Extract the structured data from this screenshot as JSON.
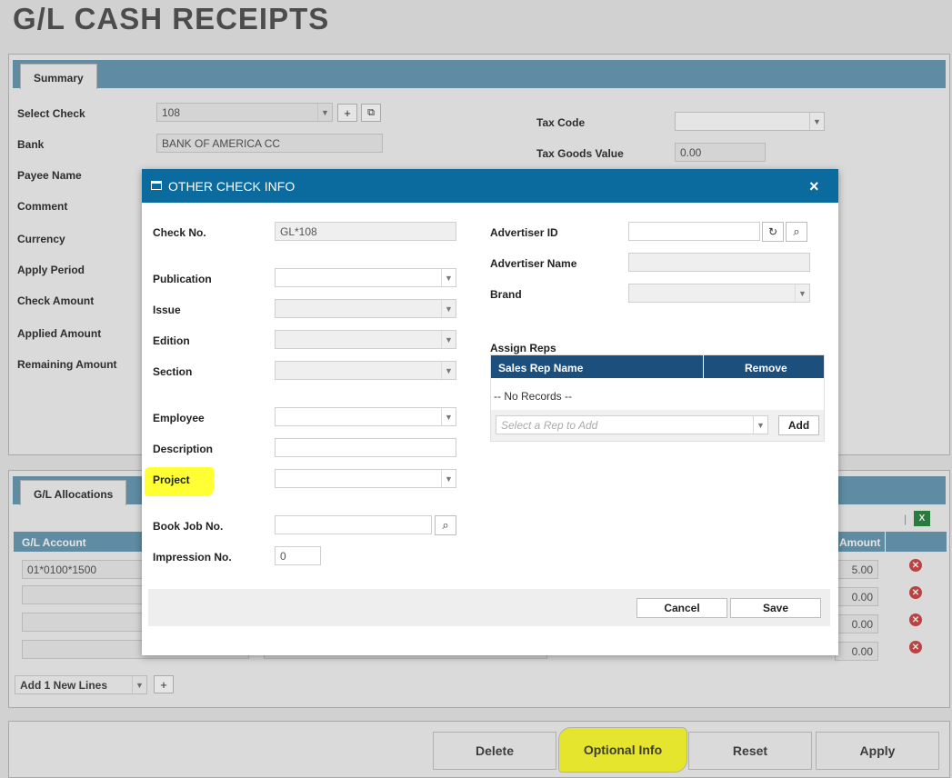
{
  "page": {
    "title": "G/L CASH RECEIPTS"
  },
  "summary": {
    "tab_label": "Summary",
    "labels": {
      "select_check": "Select Check",
      "bank": "Bank",
      "payee_name": "Payee Name",
      "comment": "Comment",
      "currency": "Currency",
      "apply_period": "Apply Period",
      "check_amount": "Check Amount",
      "applied_amount": "Applied Amount",
      "remaining_amount": "Remaining Amount",
      "tax_code": "Tax Code",
      "tax_goods_value": "Tax Goods Value"
    },
    "values": {
      "select_check": "108",
      "bank": "BANK OF AMERICA CC",
      "tax_code": "",
      "tax_goods_value": "0.00"
    }
  },
  "allocations": {
    "tab_label": "G/L Allocations",
    "columns": {
      "gl_account": "G/L Account",
      "amount": "Amount"
    },
    "rows": [
      {
        "gl_account": "01*0100*1500",
        "amount": "5.00"
      },
      {
        "gl_account": "",
        "amount": "0.00"
      },
      {
        "gl_account": "",
        "amount": "0.00"
      },
      {
        "gl_account": "",
        "amount": "0.00"
      }
    ],
    "add_lines_select": "Add 1 New Lines",
    "add_icon": "+"
  },
  "actions": {
    "delete": "Delete",
    "optional_info": "Optional Info",
    "reset": "Reset",
    "apply": "Apply"
  },
  "modal": {
    "title": "OTHER CHECK INFO",
    "close": "×",
    "labels": {
      "check_no": "Check No.",
      "publication": "Publication",
      "issue": "Issue",
      "edition": "Edition",
      "section": "Section",
      "employee": "Employee",
      "description": "Description",
      "project": "Project",
      "book_job_no": "Book Job No.",
      "impression_no": "Impression No.",
      "advertiser_id": "Advertiser ID",
      "advertiser_name": "Advertiser Name",
      "brand": "Brand",
      "assign_reps": "Assign Reps"
    },
    "values": {
      "check_no": "GL*108",
      "impression_no": "0"
    },
    "reps_table": {
      "col_name": "Sales Rep Name",
      "col_remove": "Remove",
      "empty": "-- No Records --",
      "select_placeholder": "Select a Rep to Add",
      "add_button": "Add"
    },
    "buttons": {
      "cancel": "Cancel",
      "save": "Save"
    }
  },
  "colors": {
    "modal_header": "#0b6a9e",
    "tab_bar": "#6a9cb6",
    "reps_header": "#1d4f7d",
    "highlight": "#ffff33",
    "remove_icon": "#d24a4a"
  }
}
